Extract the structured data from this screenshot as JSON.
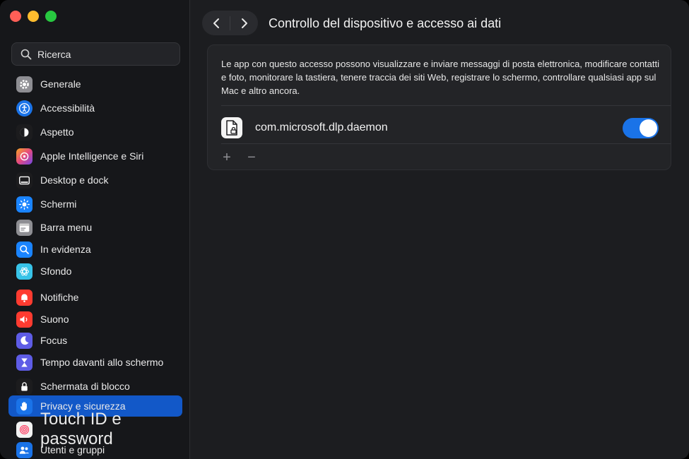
{
  "window": {
    "traffic_lights": [
      "close",
      "minimize",
      "zoom"
    ]
  },
  "search": {
    "placeholder": "Ricerca"
  },
  "sidebar": {
    "items": [
      {
        "label": "Generale",
        "icon": "gear-icon",
        "color": "#8e8e93"
      },
      {
        "label": "Accessibilità",
        "icon": "accessibility-icon",
        "color": "#1a73e8"
      },
      {
        "label": "Aspetto",
        "icon": "appearance-icon",
        "color": "#1c1c1e"
      },
      {
        "label": "Apple Intelligence e Siri",
        "icon": "siri-icon",
        "color": "#c65ce6"
      },
      {
        "label": "Desktop e dock",
        "icon": "dock-icon",
        "color": "#1c1c1e"
      },
      {
        "label": "Schermi",
        "icon": "sun-icon",
        "color": "#1a84ff"
      },
      {
        "label": "Barra menu",
        "icon": "menubar-icon",
        "color": "#8e8e93"
      },
      {
        "label": "In evidenza",
        "icon": "spotlight-icon",
        "color": "#1a84ff"
      },
      {
        "label": "Sfondo",
        "icon": "wallpaper-icon",
        "color": "#38c3e8"
      },
      {
        "label": "Notifiche",
        "icon": "bell-icon",
        "color": "#ff3b30"
      },
      {
        "label": "Suono",
        "icon": "speaker-icon",
        "color": "#ff3b30"
      },
      {
        "label": "Focus",
        "icon": "moon-icon",
        "color": "#5e5ce6"
      },
      {
        "label": "Tempo davanti allo schermo",
        "icon": "hourglass-icon",
        "color": "#5e5ce6"
      },
      {
        "label": "Schermata di blocco",
        "icon": "lock-icon",
        "color": "#1c1c1e"
      },
      {
        "label": "Privacy e sicurezza",
        "icon": "hand-icon",
        "color": "#1a73e8"
      },
      {
        "label": "Touch ID e password",
        "icon": "fingerprint-icon",
        "color": "#f2f2f2"
      },
      {
        "label": "Utenti e gruppi",
        "icon": "users-icon",
        "color": "#1a73e8"
      }
    ],
    "active": "Privacy e sicurezza"
  },
  "header": {
    "back": "back",
    "forward": "forward",
    "title": "Controllo del dispositivo e accesso ai dati"
  },
  "panel": {
    "description": "Le app con questo accesso possono visualizzare e inviare messaggi di posta elettronica, modificare contatti e foto, monitorare la tastiera, tenere traccia dei siti Web, registrare lo schermo, controllare qualsiasi app sul Mac e altro ancora.",
    "apps": [
      {
        "name": "com.microsoft.dlp.daemon",
        "enabled": true
      }
    ],
    "add_label": "+",
    "remove_label": "−"
  },
  "colors": {
    "accent": "#1a73e8",
    "selection": "#1258c8"
  }
}
